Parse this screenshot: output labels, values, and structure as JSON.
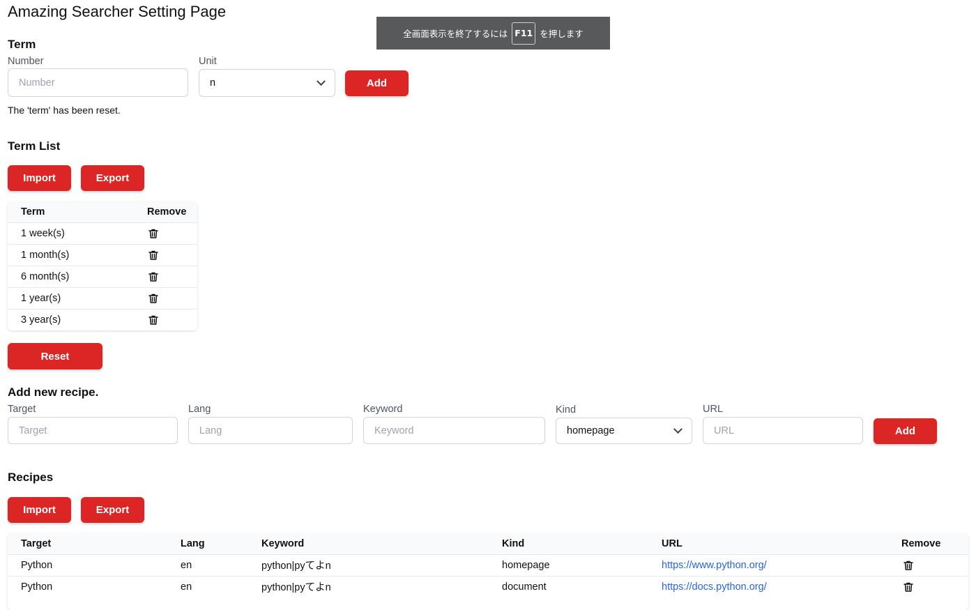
{
  "page": {
    "title": "Amazing Searcher Setting Page"
  },
  "toast": {
    "before": "全画面表示を終了するには",
    "key": "F11",
    "after": "を押します"
  },
  "term": {
    "section_title": "Term",
    "number_label": "Number",
    "number_placeholder": "Number",
    "number_value": "",
    "unit_label": "Unit",
    "unit_selected": "n",
    "add_label": "Add",
    "status": "The 'term' has been reset."
  },
  "term_list": {
    "section_title": "Term List",
    "import_label": "Import",
    "export_label": "Export",
    "columns": [
      "Term",
      "Remove"
    ],
    "rows": [
      "1 week(s)",
      "1 month(s)",
      "6 month(s)",
      "1 year(s)",
      "3 year(s)"
    ],
    "reset_label": "Reset"
  },
  "recipe_form": {
    "section_title": "Add new recipe.",
    "target_label": "Target",
    "target_placeholder": "Target",
    "lang_label": "Lang",
    "lang_placeholder": "Lang",
    "keyword_label": "Keyword",
    "keyword_placeholder": "Keyword",
    "kind_label": "Kind",
    "kind_selected": "homepage",
    "url_label": "URL",
    "url_placeholder": "URL",
    "add_label": "Add"
  },
  "recipes": {
    "section_title": "Recipes",
    "import_label": "Import",
    "export_label": "Export",
    "columns": [
      "Target",
      "Lang",
      "Keyword",
      "Kind",
      "URL",
      "Remove"
    ],
    "rows": [
      {
        "target": "Python",
        "lang": "en",
        "keyword": "python|pyてよn",
        "kind": "homepage",
        "url": "https://www.python.org/"
      },
      {
        "target": "Python",
        "lang": "en",
        "keyword": "python|pyてよn",
        "kind": "document",
        "url": "https://docs.python.org/"
      }
    ]
  },
  "colors": {
    "accent": "#dc2626",
    "link": "#2563eb",
    "toast_bg": "#57595b"
  }
}
